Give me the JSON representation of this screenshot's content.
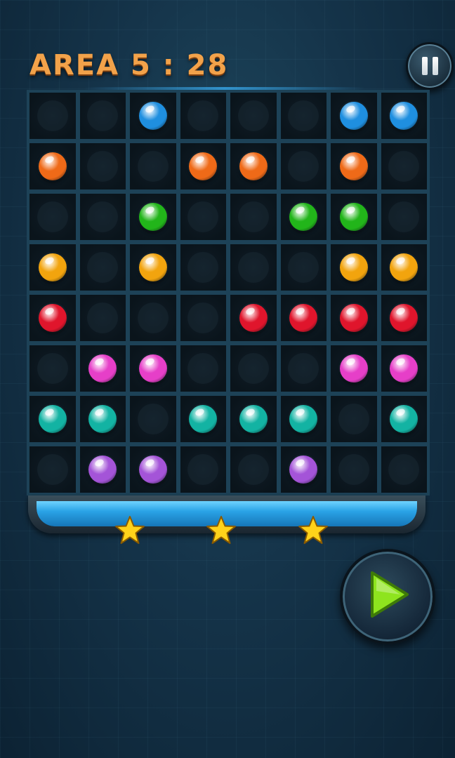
{
  "header": {
    "title": "AREA 5 : 28"
  },
  "colors": {
    "B": "#1f8fe0",
    "O": "#ef6a18",
    "G": "#22b51a",
    "Y": "#f2a40e",
    "R": "#e0152c",
    "P": "#e63fc8",
    "T": "#13b3a3",
    "V": "#a454d8"
  },
  "board": {
    "rows": [
      [
        null,
        null,
        "B",
        null,
        null,
        null,
        "B",
        "B"
      ],
      [
        "O",
        null,
        null,
        "O",
        "O",
        null,
        "O",
        null
      ],
      [
        null,
        null,
        "G",
        null,
        null,
        "G",
        "G",
        null
      ],
      [
        "Y",
        null,
        "Y",
        null,
        null,
        null,
        "Y",
        "Y"
      ],
      [
        "R",
        null,
        null,
        null,
        "R",
        "R",
        "R",
        "R"
      ],
      [
        null,
        "P",
        "P",
        null,
        null,
        null,
        "P",
        "P"
      ],
      [
        "T",
        "T",
        null,
        "T",
        "T",
        "T",
        null,
        "T"
      ],
      [
        null,
        "V",
        "V",
        null,
        null,
        "V",
        null,
        null
      ]
    ]
  },
  "progress": {
    "fill_fraction": 1.0,
    "stars_count": 3,
    "star_color": "#ffd21a"
  },
  "icons": {
    "pause": "pause-icon",
    "play": "play-icon",
    "star": "star-icon"
  },
  "accent_play": "#8ee41e"
}
